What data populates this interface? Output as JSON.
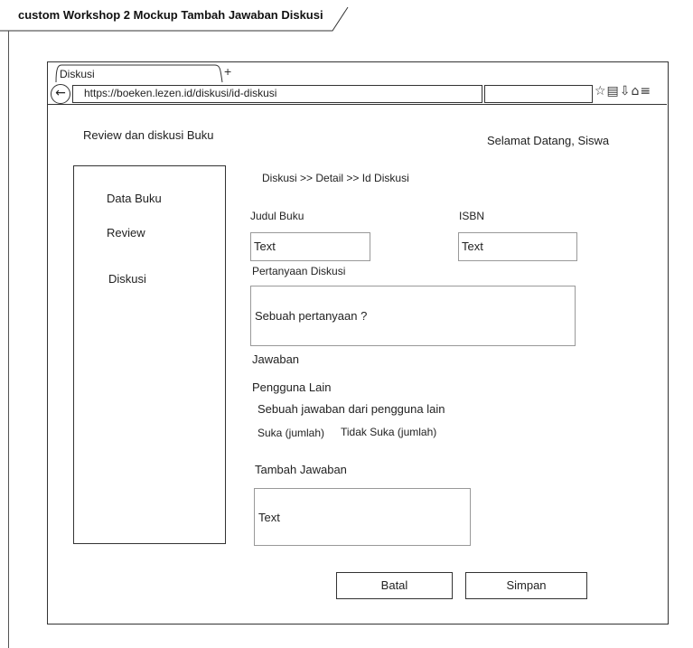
{
  "frame": {
    "title": "custom Workshop 2 Mockup Tambah Jawaban Diskusi"
  },
  "browser": {
    "tab_label": "Diskusi",
    "new_tab": "+",
    "back": "←",
    "url": "https://boeken.lezen.id/diskusi/id-diskusi",
    "toolbar_icons": "☆▤⇩⌂≡"
  },
  "header": {
    "app_title": "Review dan diskusi Buku",
    "greeting": "Selamat Datang, Siswa"
  },
  "sidebar": {
    "items": [
      {
        "label": "Data Buku"
      },
      {
        "label": "Review"
      },
      {
        "label": "Diskusi"
      }
    ]
  },
  "main": {
    "breadcrumb": "Diskusi >> Detail >> Id Diskusi",
    "judul_label": "Judul Buku",
    "judul_value": "Text",
    "isbn_label": "ISBN",
    "isbn_value": "Text",
    "pertanyaan_label": "Pertanyaan Diskusi",
    "pertanyaan_value": "Sebuah pertanyaan ?",
    "jawaban_label": "Jawaban",
    "pengguna_lain": "Pengguna Lain",
    "answer_text": "Sebuah jawaban dari pengguna lain",
    "suka": "Suka (jumlah)",
    "tidak_suka": "Tidak Suka (jumlah)",
    "tambah_label": "Tambah Jawaban",
    "tambah_value": "Text"
  },
  "actions": {
    "cancel": "Batal",
    "save": "Simpan"
  }
}
